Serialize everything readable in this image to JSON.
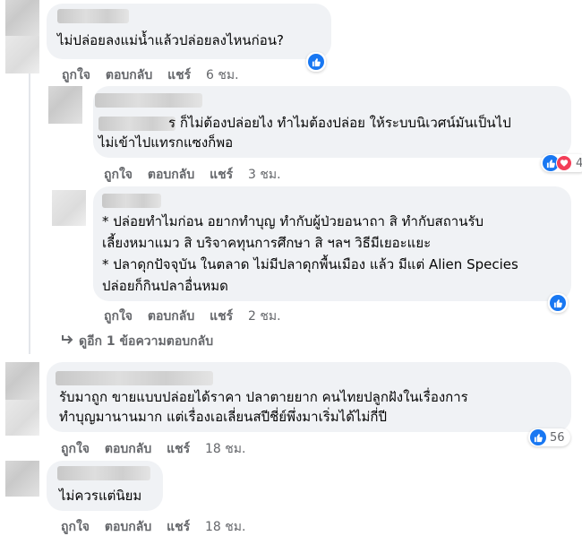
{
  "comments": [
    {
      "text_lines": [
        "ไม่ปล่อยลงแม่น้ำแล้วปล่อยลงไหนก่อน?"
      ],
      "actions": {
        "like": "ถูกใจ",
        "reply": "ตอบกลับ",
        "share": "แชร์",
        "time": "6 ชม."
      },
      "reaction_count": ""
    },
    {
      "text_lines": [
        "ร ก็ไม่ต้องปล่อยไง ทำไมต้องปล่อย ให้ระบบนิเวศน์มันเป็นไป",
        "ไม่เข้าไปแทรกแซงก็พอ"
      ],
      "actions": {
        "like": "ถูกใจ",
        "reply": "ตอบกลับ",
        "share": "แชร์",
        "time": "3 ชม."
      },
      "reaction_count": "4"
    },
    {
      "text_lines": [
        "* ปล่อยทำไมก่อน อยากทำบุญ ทำกับผู้ป่วยอนาถา สิ ทำกับสถานรับ",
        "เลี้ยงหมาแมว สิ บริจาคทุนการศึกษา สิ ฯลฯ วิธีมีเยอะแยะ",
        "* ปลาดุกปัจจุบัน ในตลาด ไม่มีปลาดุกพื้นเมือง แล้ว มีแต่ Alien Species",
        "ปล่อยก็กินปลาอื่นหมด"
      ],
      "actions": {
        "like": "ถูกใจ",
        "reply": "ตอบกลับ",
        "share": "แชร์",
        "time": "2 ชม."
      },
      "reaction_count": ""
    },
    {
      "text_lines": [
        "รับมาถูก ขายแบบปล่อยได้ราคา ปลาตายยาก คนไทยปลูกฝังในเรื่องการ",
        "ทำบุญมานานมาก แต่เรื่องเอเลี่ยนสปีชี่ย์พึ่งมาเริ่มได้ไม่กี่ปี"
      ],
      "actions": {
        "like": "ถูกใจ",
        "reply": "ตอบกลับ",
        "share": "แชร์",
        "time": "18 ชม."
      },
      "reaction_count": "56"
    },
    {
      "text_lines": [
        "ไม่ควรแต่นิยม"
      ],
      "actions": {
        "like": "ถูกใจ",
        "reply": "ตอบกลับ",
        "share": "แชร์",
        "time": "18 ชม."
      },
      "reaction_count": ""
    }
  ],
  "more_replies": "ดูอีก 1 ข้อความตอบกลับ",
  "colors": {
    "like": "#1877f2",
    "love": "#f33e58",
    "bubble": "#f0f2f5",
    "meta": "#65676b"
  },
  "icons": [
    "like-icon",
    "love-icon",
    "reply-arrow-icon"
  ]
}
